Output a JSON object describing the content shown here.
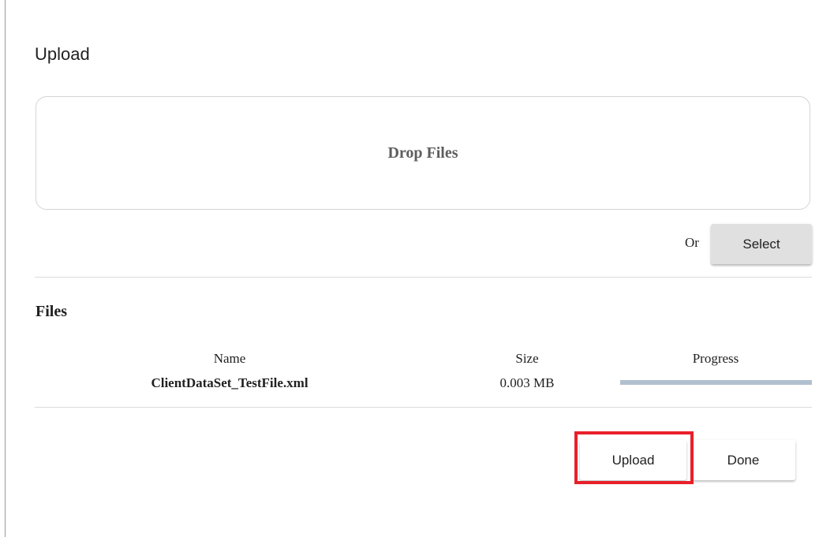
{
  "dialog": {
    "title": "Upload",
    "drop_zone_label": "Drop Files",
    "or_label": "Or",
    "select_label": "Select"
  },
  "files": {
    "heading": "Files",
    "columns": {
      "name": "Name",
      "size": "Size",
      "progress": "Progress"
    },
    "rows": [
      {
        "name": "ClientDataSet_TestFile.xml",
        "size": "0.003 MB",
        "progress": 1.0
      }
    ]
  },
  "actions": {
    "upload_label": "Upload",
    "done_label": "Done"
  },
  "colors": {
    "highlight": "#e8202a",
    "progress_fill": "#b1c0cf"
  }
}
